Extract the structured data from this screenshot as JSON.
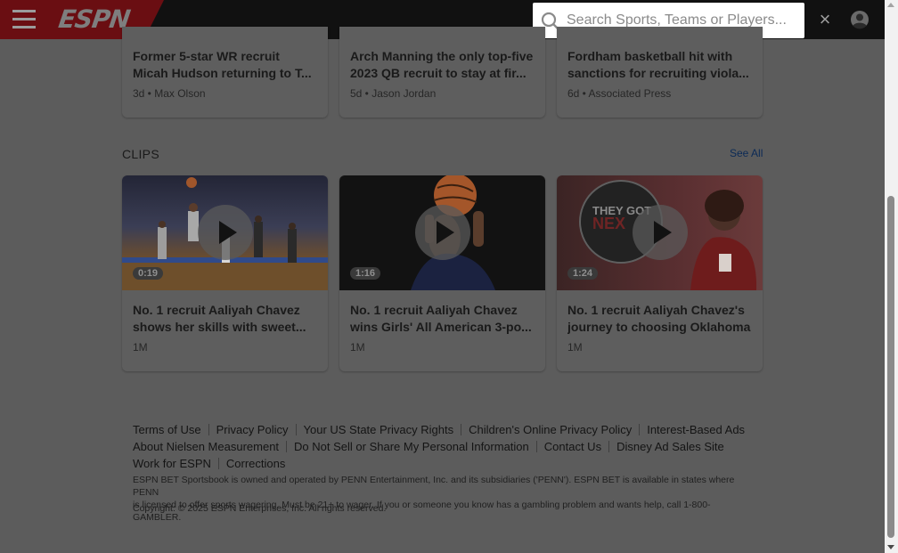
{
  "header": {
    "logo": "ESPN",
    "search_placeholder": "Search Sports, Teams or Players...",
    "close_symbol": "×",
    "brand_color": "#CC0000"
  },
  "top_articles": [
    {
      "line1": "Former 5-star WR recruit",
      "line2": "Micah Hudson returning to T...",
      "meta": "3d • Max Olson"
    },
    {
      "line1": "Arch Manning the only top-five",
      "line2": "2023 QB recruit to stay at fir...",
      "meta": "5d • Jason Jordan"
    },
    {
      "line1": "Fordham basketball hit with",
      "line2": "sanctions for recruiting viola...",
      "meta": "6d • Associated Press"
    }
  ],
  "clips": {
    "title": "CLIPS",
    "see_all": "See All",
    "items": [
      {
        "duration": "0:19",
        "line1": "No. 1 recruit Aaliyah Chavez",
        "line2": "shows her skills with sweet...",
        "meta": "1M"
      },
      {
        "duration": "1:16",
        "line1": "No. 1 recruit Aaliyah Chavez",
        "line2": "wins Girls' All American 3-po...",
        "meta": "1M"
      },
      {
        "duration": "1:24",
        "line1": "No. 1 recruit Aaliyah Chavez's",
        "line2": "journey to choosing Oklahoma",
        "meta": "1M",
        "badge_line1": "THEY GOT",
        "badge_line2": "NEX"
      }
    ]
  },
  "footer": {
    "row1": [
      "Terms of Use",
      "Privacy Policy",
      "Your US State Privacy Rights",
      "Children's Online Privacy Policy",
      "Interest-Based Ads"
    ],
    "row2": [
      "About Nielsen Measurement",
      "Do Not Sell or Share My Personal Information",
      "Contact Us",
      "Disney Ad Sales Site"
    ],
    "row3": [
      "Work for ESPN",
      "Corrections"
    ],
    "legal_line1": "ESPN BET Sportsbook is owned and operated by PENN Entertainment, Inc. and its subsidiaries ('PENN'). ESPN BET is available in states where PENN",
    "legal_line2": "is licensed to offer sports wagering. Must be 21+ to wager. If you or someone you know has a gambling problem and wants help, call 1-800-GAMBLER.",
    "copyright": "Copyright: © 2025 ESPN Enterprises, Inc. All rights reserved."
  }
}
